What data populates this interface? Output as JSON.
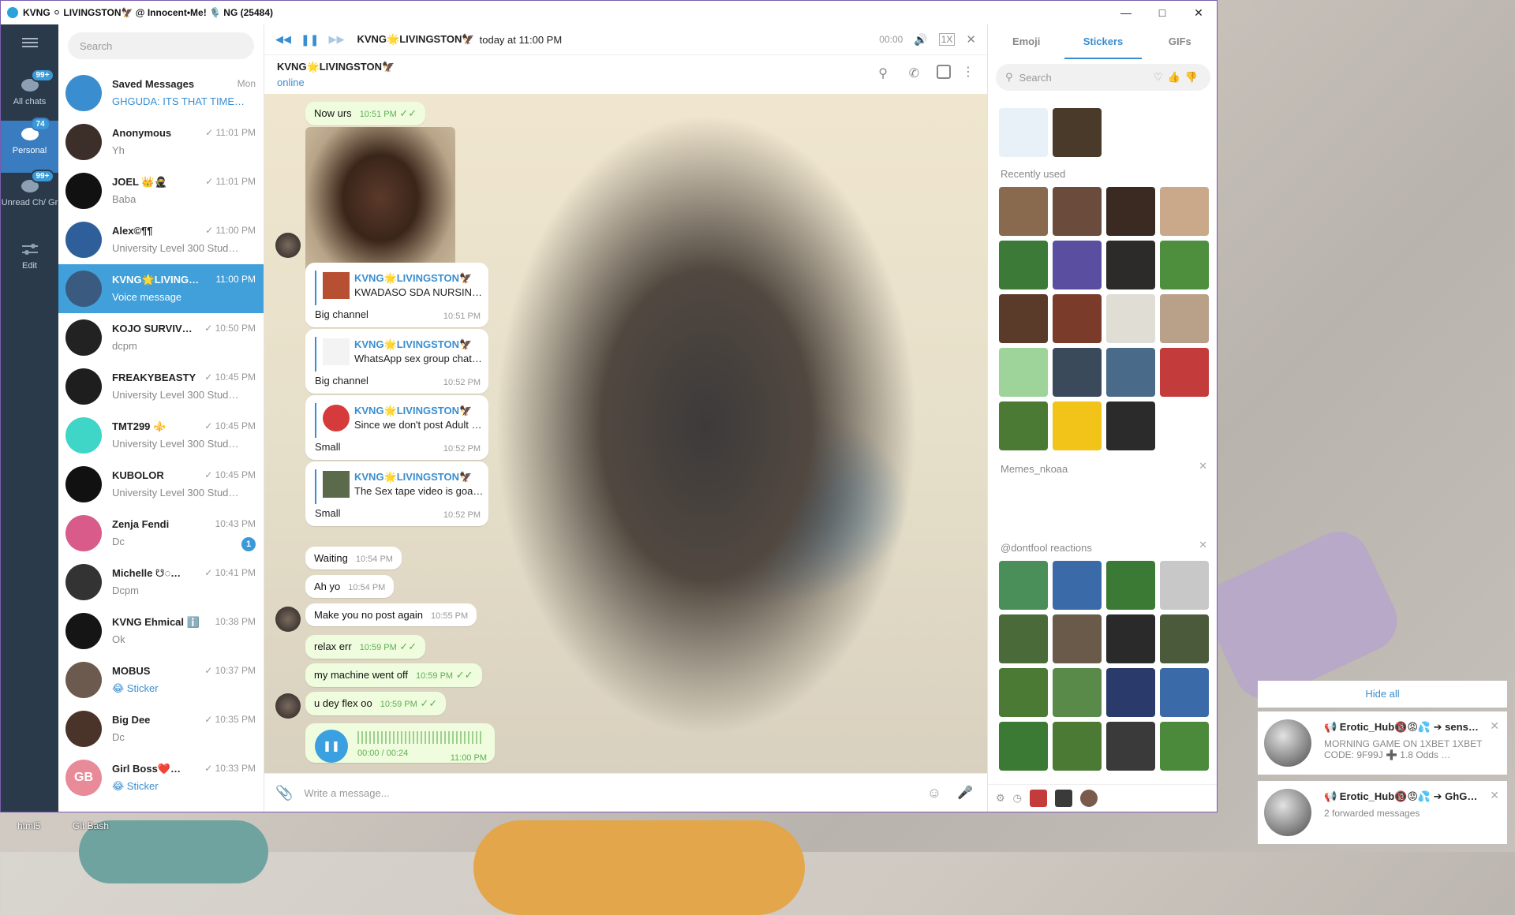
{
  "window": {
    "title": "KVNG ⚪ LIVINGSTON🦅 @ Innocent•Me! 🎙️ NG (25484)"
  },
  "rail": [
    {
      "label": "All chats",
      "badge": "99+"
    },
    {
      "label": "Personal",
      "badge": "74"
    },
    {
      "label": "Unread Ch/ Gr",
      "badge": "99+"
    },
    {
      "label": "Edit",
      "badge": ""
    }
  ],
  "list": {
    "search_placeholder": "Search",
    "chats": [
      {
        "name": "Saved Messages",
        "time": "Mon",
        "preview": "GHGUDA: ITS THAT TIME…",
        "color": "#3a8ed0"
      },
      {
        "name": "Anonymous",
        "time": "✓ 11:01 PM",
        "preview": "Yh",
        "color": "#3c2f29"
      },
      {
        "name": "JOEL 👑🥷",
        "time": "✓ 11:01 PM",
        "preview": "Baba",
        "color": "#111"
      },
      {
        "name": "Alex©¶¶",
        "time": "✓ 11:00 PM",
        "preview": "University Level 300 Stud…",
        "color": "#2f5f9a"
      },
      {
        "name": "KVNG🌟LIVING…",
        "time": "11:00 PM",
        "preview": "Voice message",
        "color": "#3a5a80"
      },
      {
        "name": "KOJO SURVIV…",
        "time": "✓ 10:50 PM",
        "preview": "dcpm",
        "color": "#222"
      },
      {
        "name": "FREAKYBEASTY",
        "time": "✓ 10:45 PM",
        "preview": "University Level 300 Stud…",
        "color": "#1e1e1e"
      },
      {
        "name": "TMT299 ⚜️",
        "time": "✓ 10:45 PM",
        "preview": "University Level 300 Stud…",
        "color": "#3fd6c8"
      },
      {
        "name": "KUBOLOR",
        "time": "✓ 10:45 PM",
        "preview": "University Level 300 Stud…",
        "color": "#111"
      },
      {
        "name": "Zenja Fendi",
        "time": "10:43 PM",
        "preview": "Dc",
        "color": "#d95b8a",
        "unread": "1"
      },
      {
        "name": "Michelle ☋◌…",
        "time": "✓ 10:41 PM",
        "preview": "Dcpm",
        "color": "#333"
      },
      {
        "name": "KVNG Ehmical ℹ️",
        "time": "10:38 PM",
        "preview": "Ok",
        "color": "#151515"
      },
      {
        "name": "MOBUS",
        "time": "✓ 10:37 PM",
        "preview": "😂 Sticker",
        "color": "#6d5a4e"
      },
      {
        "name": "Big Dee",
        "time": "✓ 10:35 PM",
        "preview": "Dc",
        "color": "#4a3328"
      },
      {
        "name": "Girl Boss❤️…",
        "time": "✓ 10:33 PM",
        "preview": "😂 Sticker",
        "color": "#e88a97",
        "initials": "GB"
      }
    ]
  },
  "player": {
    "title": "KVNG🌟LIVINGSTON🦅",
    "subtitle": "today at 11:00 PM",
    "position": "00:00",
    "speed": "1X"
  },
  "header": {
    "name": "KVNG🌟LIVINGSTON🦅",
    "status": "online"
  },
  "messages": {
    "m1": {
      "text": "Now urs",
      "time": "10:51 PM"
    },
    "f1": {
      "title": "KVNG🌟LIVINGSTON🦅",
      "text": "KWADASO SDA NURSING …",
      "label": "Big channel",
      "time": "10:51 PM"
    },
    "f2": {
      "title": "KVNG🌟LIVINGSTON🦅",
      "text": "WhatsApp sex group chat …",
      "label": "Big channel",
      "time": "10:52 PM"
    },
    "f3": {
      "title": "KVNG🌟LIVINGSTON🦅",
      "text": "Since we don't post Adult …",
      "label": "Small",
      "time": "10:52 PM"
    },
    "f4": {
      "title": "KVNG🌟LIVINGSTON🦅",
      "text": "The Sex tape video is goat…",
      "label": "Small",
      "time": "10:52 PM"
    },
    "m2": {
      "text": "Waiting",
      "time": "10:54 PM"
    },
    "m3": {
      "text": "Ah yo",
      "time": "10:54 PM"
    },
    "m4": {
      "text": "Make you no post again",
      "time": "10:55 PM"
    },
    "m5": {
      "text": "relax err",
      "time": "10:59 PM"
    },
    "m6": {
      "text": "my machine went off",
      "time": "10:59 PM"
    },
    "m7": {
      "text": "u dey flex oo",
      "time": "10:59 PM"
    },
    "voice": {
      "duration": "00:00 / 00:24",
      "time": "11:00 PM"
    }
  },
  "compose": {
    "placeholder": "Write a message..."
  },
  "panel": {
    "tabs": [
      "Emoji",
      "Stickers",
      "GIFs"
    ],
    "search_placeholder": "Search",
    "sections": [
      "Recently used",
      "Memes_nkoaa",
      "@dontfool reactions"
    ],
    "sticker_colors": [
      "#8a6a4f",
      "#6b4b3b",
      "#3b2a22",
      "#c9a98a",
      "#3c7a37",
      "#5a4ea0",
      "#2d2a2a",
      "#4d8f3c",
      "#5a3b2a",
      "#7a3b2a",
      "#e0ddd5",
      "#b8a089",
      "#9ed49a",
      "#3a4a5a",
      "#4a6a8a",
      "#c33b3b",
      "#4a7a34",
      "#f2c318",
      "#2b2b2b",
      "#ffffff",
      "#4a8f5a",
      "#3a6aa8",
      "#3b7a34",
      "#c8c8c8",
      "#4a6a3a",
      "#6a5a4a",
      "#2a2a2a",
      "#4a5a3a",
      "#4a7a34",
      "#5a8a4a",
      "#2a3a6a",
      "#3a6aa8",
      "#3b7a34",
      "#4a7a34",
      "#3a3a3a",
      "#4b8a3a"
    ]
  },
  "notifications": {
    "hide_all": "Hide all",
    "items": [
      {
        "title": "📢 Erotic_Hub🔞😡💦 ➔ sens…",
        "body": "MORNING GAME ON 1XBET 1XBET CODE: 9F99J ➕ 1.8 Odds …"
      },
      {
        "title": "📢 Erotic_Hub🔞😡💦 ➔ GhG…",
        "body": "2 forwarded messages"
      }
    ]
  },
  "desktop": {
    "icons": [
      "html5",
      "Git Bash"
    ]
  }
}
